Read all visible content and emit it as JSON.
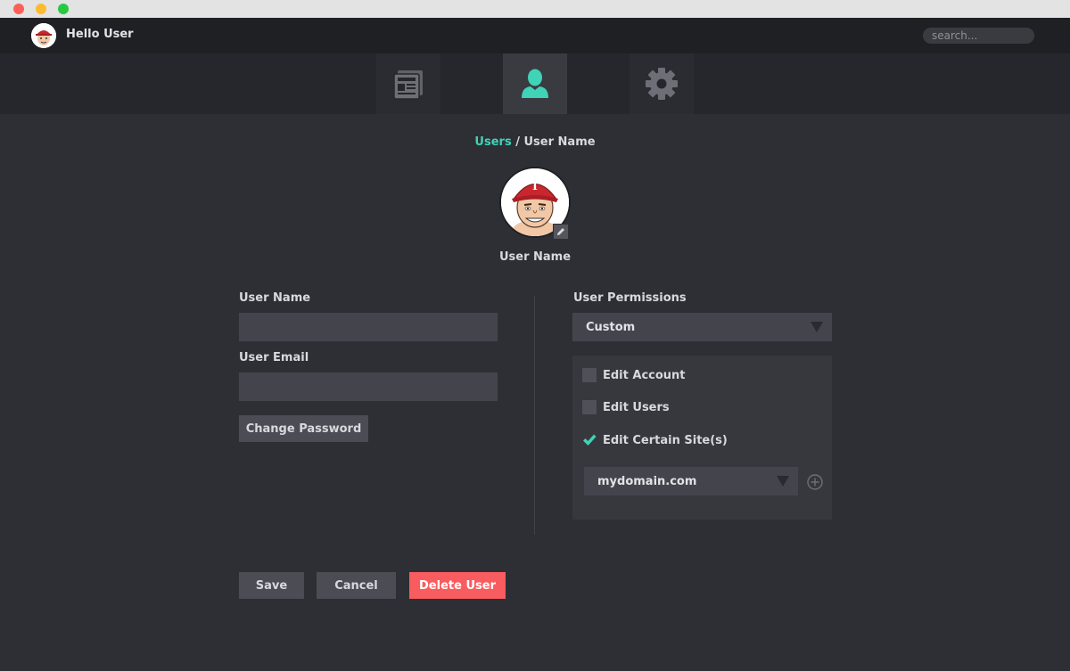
{
  "header": {
    "greeting": "Hello User",
    "search_placeholder": "search..."
  },
  "nav": {
    "tabs": [
      {
        "icon": "news-icon",
        "active": false
      },
      {
        "icon": "user-icon",
        "active": true
      },
      {
        "icon": "gear-icon",
        "active": false
      }
    ]
  },
  "breadcrumb": {
    "parent": "Users",
    "separator": " / ",
    "current": "User Name"
  },
  "profile": {
    "name": "User Name"
  },
  "form": {
    "user_name_label": "User Name",
    "user_name_value": "",
    "user_email_label": "User Email",
    "user_email_value": "",
    "change_password_label": "Change Password"
  },
  "permissions": {
    "label": "User Permissions",
    "selected": "Custom",
    "options": [
      {
        "label": "Edit Account",
        "checked": false
      },
      {
        "label": "Edit Users",
        "checked": false
      },
      {
        "label": "Edit Certain Site(s)",
        "checked": true
      }
    ],
    "site_selected": "mydomain.com"
  },
  "actions": {
    "save_label": "Save",
    "cancel_label": "Cancel",
    "delete_label": "Delete User"
  },
  "colors": {
    "accent": "#3fd3b7",
    "danger": "#f85c5f",
    "background": "#2e2f34"
  }
}
